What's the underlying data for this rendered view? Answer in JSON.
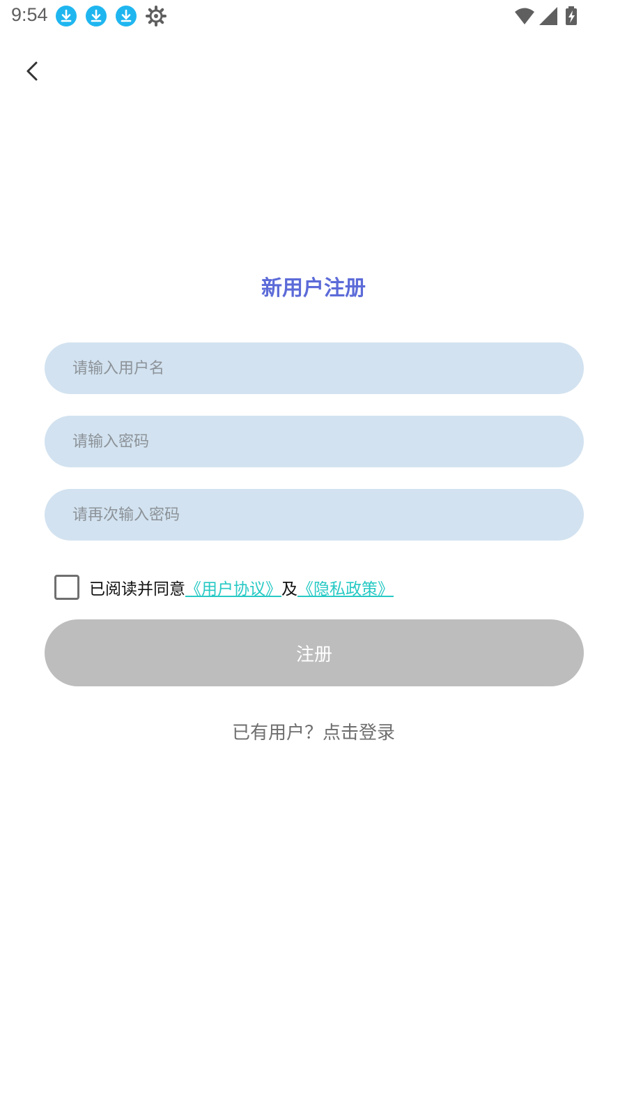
{
  "status_bar": {
    "time": "9:54",
    "icons": [
      "download-icon",
      "download-icon",
      "download-icon",
      "settings-icon",
      "wifi-icon",
      "signal-icon",
      "battery-charging-icon"
    ],
    "download_badge_color": "#1fb6f0"
  },
  "header": {
    "back_icon": "chevron-left-icon"
  },
  "form": {
    "title": "新用户注册",
    "username_placeholder": "请输入用户名",
    "password_placeholder": "请输入密码",
    "confirm_password_placeholder": "请再次输入密码",
    "agreement": {
      "checked": false,
      "prefix": "已阅读并同意",
      "user_agreement": "《用户协议》",
      "conjunction": "及",
      "privacy_policy": "《隐私政策》"
    },
    "register_label": "注册",
    "login_prompt": "已有用户？点击登录"
  },
  "colors": {
    "title": "#5c6bd8",
    "input_bg": "#d2e2f0",
    "link": "#27c9c4",
    "button_disabled": "#bdbdbd"
  }
}
